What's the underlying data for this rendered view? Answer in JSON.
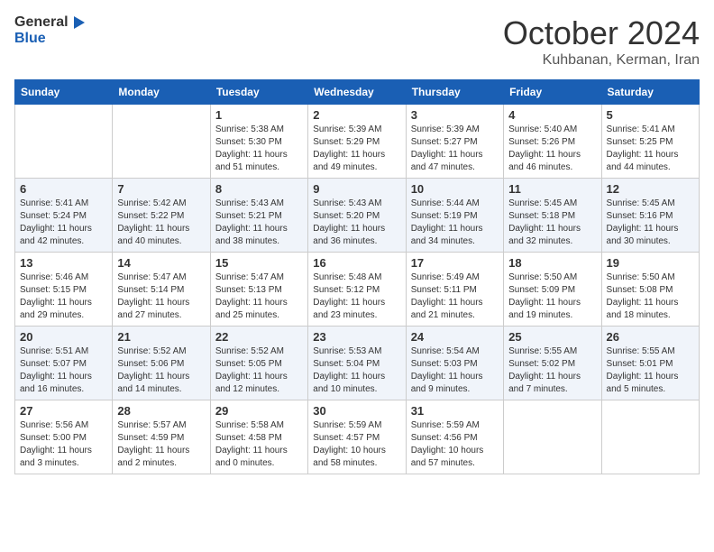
{
  "header": {
    "logo_line1": "General",
    "logo_line2": "Blue",
    "month": "October 2024",
    "location": "Kuhbanan, Kerman, Iran"
  },
  "days_of_week": [
    "Sunday",
    "Monday",
    "Tuesday",
    "Wednesday",
    "Thursday",
    "Friday",
    "Saturday"
  ],
  "weeks": [
    [
      {
        "num": "",
        "info": ""
      },
      {
        "num": "",
        "info": ""
      },
      {
        "num": "1",
        "info": "Sunrise: 5:38 AM\nSunset: 5:30 PM\nDaylight: 11 hours\nand 51 minutes."
      },
      {
        "num": "2",
        "info": "Sunrise: 5:39 AM\nSunset: 5:29 PM\nDaylight: 11 hours\nand 49 minutes."
      },
      {
        "num": "3",
        "info": "Sunrise: 5:39 AM\nSunset: 5:27 PM\nDaylight: 11 hours\nand 47 minutes."
      },
      {
        "num": "4",
        "info": "Sunrise: 5:40 AM\nSunset: 5:26 PM\nDaylight: 11 hours\nand 46 minutes."
      },
      {
        "num": "5",
        "info": "Sunrise: 5:41 AM\nSunset: 5:25 PM\nDaylight: 11 hours\nand 44 minutes."
      }
    ],
    [
      {
        "num": "6",
        "info": "Sunrise: 5:41 AM\nSunset: 5:24 PM\nDaylight: 11 hours\nand 42 minutes."
      },
      {
        "num": "7",
        "info": "Sunrise: 5:42 AM\nSunset: 5:22 PM\nDaylight: 11 hours\nand 40 minutes."
      },
      {
        "num": "8",
        "info": "Sunrise: 5:43 AM\nSunset: 5:21 PM\nDaylight: 11 hours\nand 38 minutes."
      },
      {
        "num": "9",
        "info": "Sunrise: 5:43 AM\nSunset: 5:20 PM\nDaylight: 11 hours\nand 36 minutes."
      },
      {
        "num": "10",
        "info": "Sunrise: 5:44 AM\nSunset: 5:19 PM\nDaylight: 11 hours\nand 34 minutes."
      },
      {
        "num": "11",
        "info": "Sunrise: 5:45 AM\nSunset: 5:18 PM\nDaylight: 11 hours\nand 32 minutes."
      },
      {
        "num": "12",
        "info": "Sunrise: 5:45 AM\nSunset: 5:16 PM\nDaylight: 11 hours\nand 30 minutes."
      }
    ],
    [
      {
        "num": "13",
        "info": "Sunrise: 5:46 AM\nSunset: 5:15 PM\nDaylight: 11 hours\nand 29 minutes."
      },
      {
        "num": "14",
        "info": "Sunrise: 5:47 AM\nSunset: 5:14 PM\nDaylight: 11 hours\nand 27 minutes."
      },
      {
        "num": "15",
        "info": "Sunrise: 5:47 AM\nSunset: 5:13 PM\nDaylight: 11 hours\nand 25 minutes."
      },
      {
        "num": "16",
        "info": "Sunrise: 5:48 AM\nSunset: 5:12 PM\nDaylight: 11 hours\nand 23 minutes."
      },
      {
        "num": "17",
        "info": "Sunrise: 5:49 AM\nSunset: 5:11 PM\nDaylight: 11 hours\nand 21 minutes."
      },
      {
        "num": "18",
        "info": "Sunrise: 5:50 AM\nSunset: 5:09 PM\nDaylight: 11 hours\nand 19 minutes."
      },
      {
        "num": "19",
        "info": "Sunrise: 5:50 AM\nSunset: 5:08 PM\nDaylight: 11 hours\nand 18 minutes."
      }
    ],
    [
      {
        "num": "20",
        "info": "Sunrise: 5:51 AM\nSunset: 5:07 PM\nDaylight: 11 hours\nand 16 minutes."
      },
      {
        "num": "21",
        "info": "Sunrise: 5:52 AM\nSunset: 5:06 PM\nDaylight: 11 hours\nand 14 minutes."
      },
      {
        "num": "22",
        "info": "Sunrise: 5:52 AM\nSunset: 5:05 PM\nDaylight: 11 hours\nand 12 minutes."
      },
      {
        "num": "23",
        "info": "Sunrise: 5:53 AM\nSunset: 5:04 PM\nDaylight: 11 hours\nand 10 minutes."
      },
      {
        "num": "24",
        "info": "Sunrise: 5:54 AM\nSunset: 5:03 PM\nDaylight: 11 hours\nand 9 minutes."
      },
      {
        "num": "25",
        "info": "Sunrise: 5:55 AM\nSunset: 5:02 PM\nDaylight: 11 hours\nand 7 minutes."
      },
      {
        "num": "26",
        "info": "Sunrise: 5:55 AM\nSunset: 5:01 PM\nDaylight: 11 hours\nand 5 minutes."
      }
    ],
    [
      {
        "num": "27",
        "info": "Sunrise: 5:56 AM\nSunset: 5:00 PM\nDaylight: 11 hours\nand 3 minutes."
      },
      {
        "num": "28",
        "info": "Sunrise: 5:57 AM\nSunset: 4:59 PM\nDaylight: 11 hours\nand 2 minutes."
      },
      {
        "num": "29",
        "info": "Sunrise: 5:58 AM\nSunset: 4:58 PM\nDaylight: 11 hours\nand 0 minutes."
      },
      {
        "num": "30",
        "info": "Sunrise: 5:59 AM\nSunset: 4:57 PM\nDaylight: 10 hours\nand 58 minutes."
      },
      {
        "num": "31",
        "info": "Sunrise: 5:59 AM\nSunset: 4:56 PM\nDaylight: 10 hours\nand 57 minutes."
      },
      {
        "num": "",
        "info": ""
      },
      {
        "num": "",
        "info": ""
      }
    ]
  ]
}
